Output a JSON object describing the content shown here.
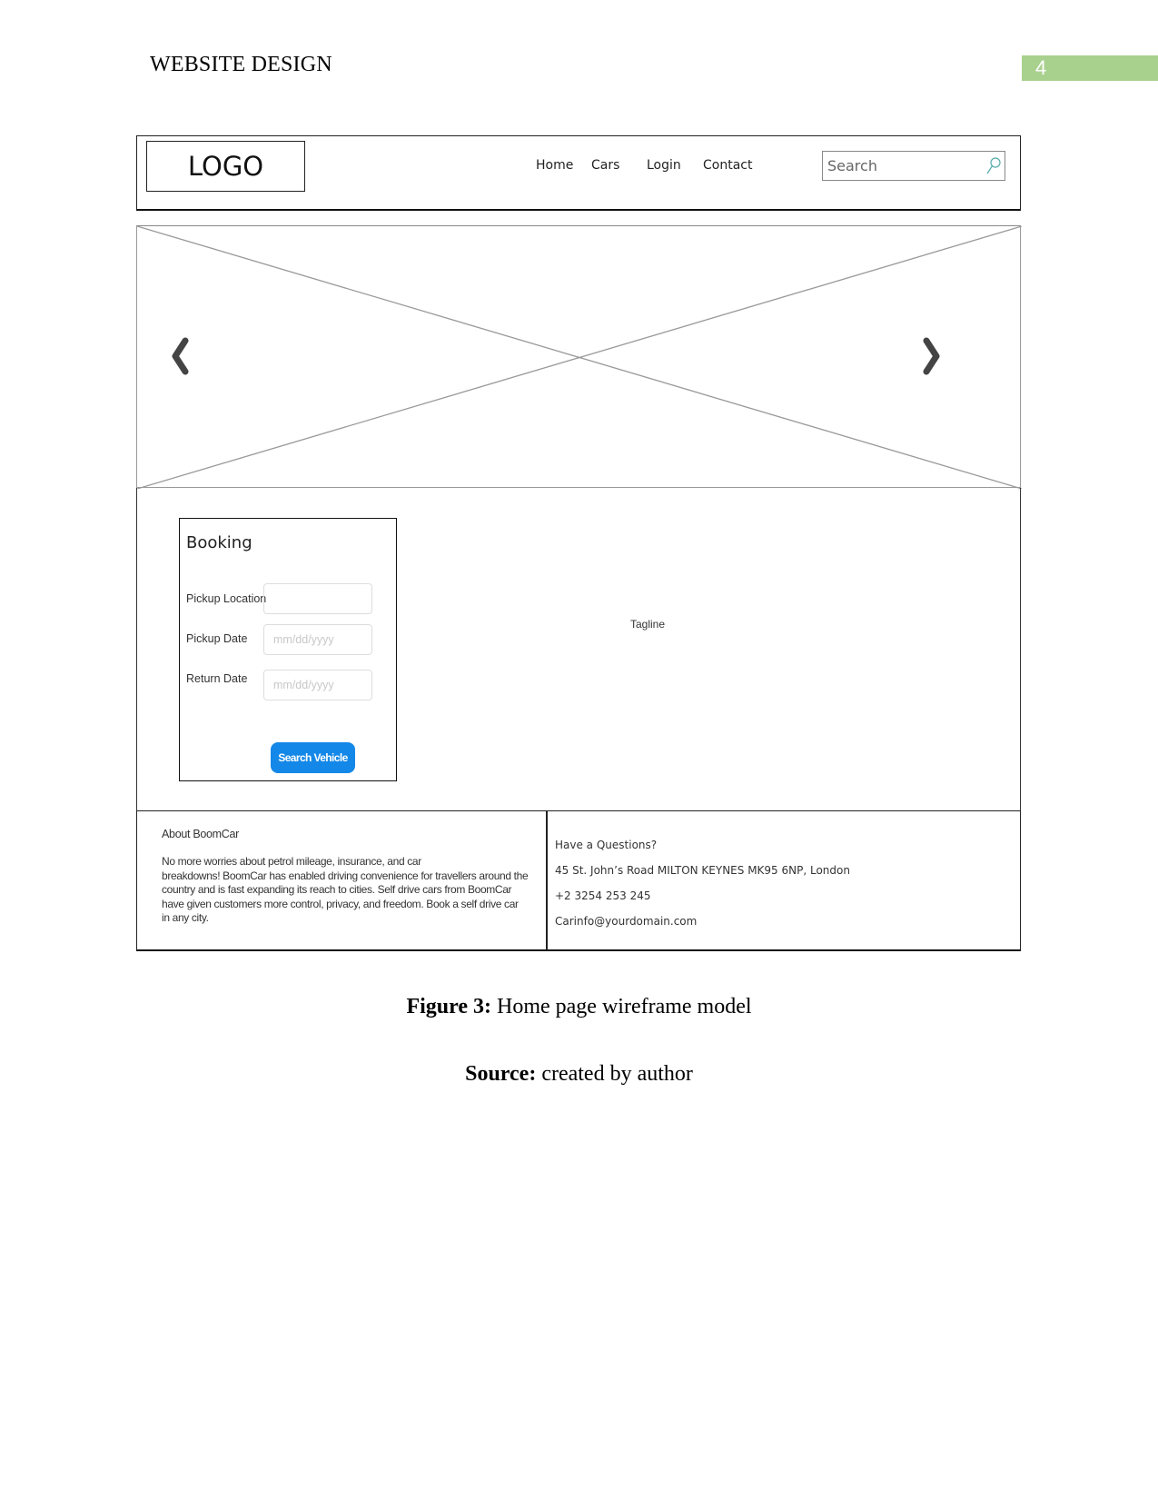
{
  "document": {
    "running_header": "WEBSITE DESIGN",
    "page_number": "4",
    "page_number_bar_color": "#a9d18e"
  },
  "wireframe": {
    "header": {
      "logo": "LOGO",
      "nav": [
        "Home",
        "Cars",
        "Login",
        "Contact"
      ],
      "search_placeholder": "Search",
      "search_icon": "magnifier-icon"
    },
    "hero": {
      "placeholder": "image-placeholder",
      "prev_icon": "chevron-left-icon",
      "next_icon": "chevron-right-icon"
    },
    "booking": {
      "title": "Booking",
      "fields": [
        {
          "label": "Pickup Location",
          "placeholder": ""
        },
        {
          "label": "Pickup Date",
          "placeholder": "mm/dd/yyyy"
        },
        {
          "label": "Return Date",
          "placeholder": "mm/dd/yyyy"
        }
      ],
      "button_label": "Search Vehicle",
      "button_color": "#1488e8"
    },
    "tagline": "Tagline",
    "footer": {
      "about_title": "About BoomCar",
      "about_lines": [
        "No more worries about petrol mileage, insurance, and car",
        "breakdowns! BoomCar has enabled driving convenience for travellers around the",
        "country and is fast expanding its reach to cities. Self drive cars from BoomCar",
        "have given customers more control, privacy, and freedom. Book a self drive car",
        "in any city."
      ],
      "contact": {
        "heading": "Have a Questions?",
        "address": "45 St. John’s Road MILTON KEYNES MK95 6NP, London",
        "phone": "+2 3254 253 245",
        "email": "Carinfo@yourdomain.com"
      }
    }
  },
  "caption": {
    "figure_label": "Figure 3:",
    "figure_text": " Home page wireframe model",
    "source_label": "Source:",
    "source_text": " created by author"
  }
}
